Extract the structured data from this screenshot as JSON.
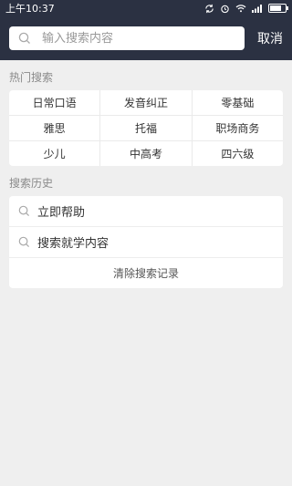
{
  "status": {
    "time": "上午10:37",
    "icons": [
      "sync-icon",
      "alarm-icon",
      "wifi-icon",
      "signal-icon",
      "battery-icon"
    ]
  },
  "search": {
    "placeholder": "输入搜索内容",
    "value": "",
    "cancel_label": "取消"
  },
  "hot": {
    "title": "热门搜索",
    "rows": [
      [
        "日常口语",
        "发音纠正",
        "零基础"
      ],
      [
        "雅思",
        "托福",
        "职场商务"
      ],
      [
        "少儿",
        "中高考",
        "四六级"
      ]
    ]
  },
  "history": {
    "title": "搜索历史",
    "items": [
      "立即帮助",
      "搜索就学内容"
    ],
    "clear_label": "清除搜索记录"
  },
  "colors": {
    "header_bg": "#2b3142",
    "page_bg": "#efefef"
  }
}
